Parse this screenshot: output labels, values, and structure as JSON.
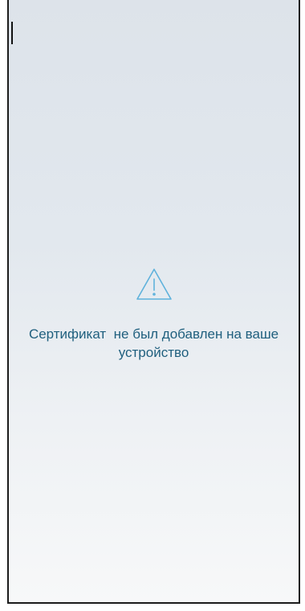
{
  "screen": {
    "icon": "warning-triangle-icon",
    "icon_color": "#5fb2dc",
    "message": "Сертификат  не был добавлен на ваше устройство",
    "message_color": "#1f5f7e"
  }
}
